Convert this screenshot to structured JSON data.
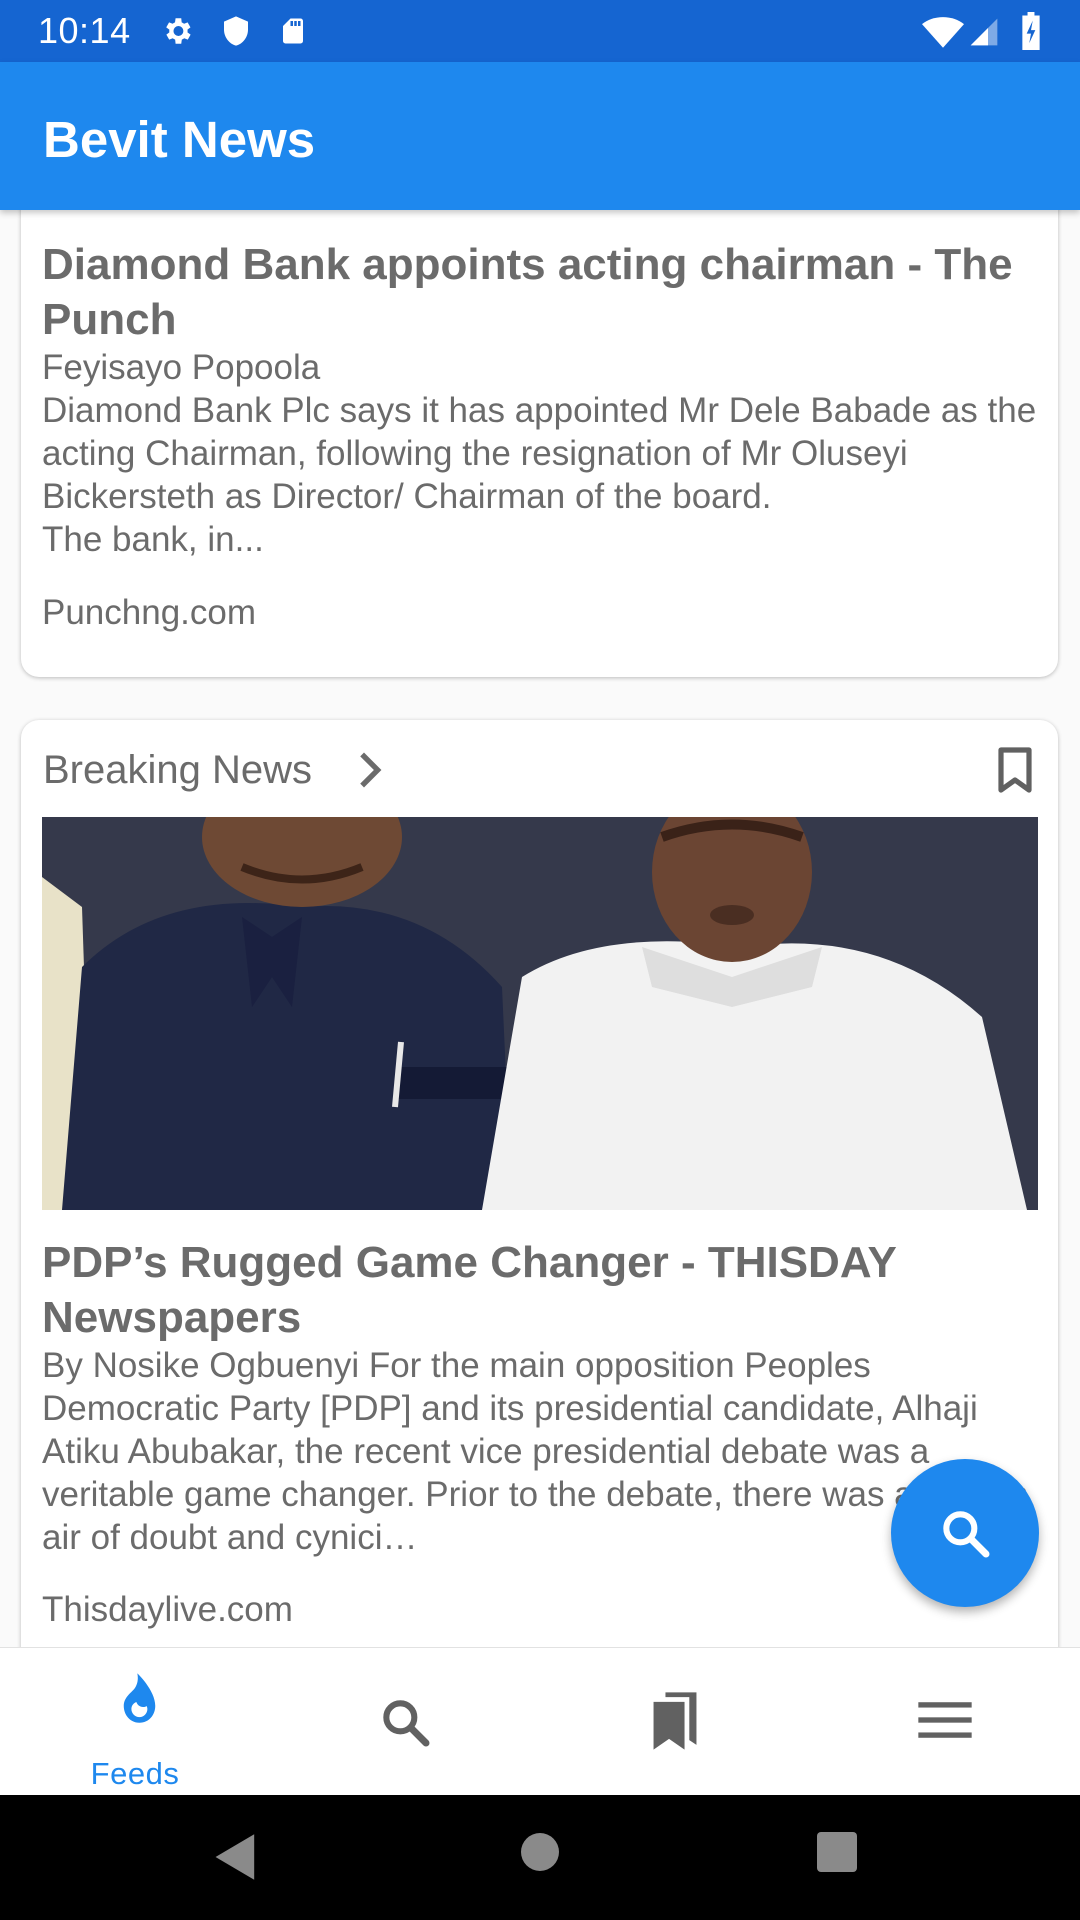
{
  "status_bar": {
    "time": "10:14",
    "icons": [
      "settings-icon",
      "shield-icon",
      "sd-card-icon",
      "wifi-icon",
      "signal-icon",
      "battery-icon"
    ]
  },
  "app_bar": {
    "title": "Bevit News"
  },
  "articles": [
    {
      "title": "Diamond Bank appoints acting chairman - The Punch",
      "description": "Feyisayo Popoola\nDiamond Bank Plc says it has appointed Mr Dele Babade as the acting Chairman, following the resignation of Mr Oluseyi Bickersteth as Director/ Chairman of the board.\nThe bank, in...",
      "source": "Punchng.com"
    },
    {
      "category": "Breaking News",
      "title": "PDP’s Rugged Game Changer - THISDAY Newspapers",
      "description": "By Nosike Ogbuenyi For the main opposition Peoples Democratic Party [PDP] and its presidential candidate, Alhaji Atiku Abubakar, the recent vice presidential debate was a veritable game changer. Prior to the debate, there was a certain air of doubt and cynici…",
      "source": "Thisdaylive.com"
    }
  ],
  "bottom_nav": [
    {
      "label": "Feeds",
      "icon": "flame-icon",
      "active": true
    },
    {
      "label": "",
      "icon": "search-icon",
      "active": false
    },
    {
      "label": "",
      "icon": "bookmarks-icon",
      "active": false
    },
    {
      "label": "",
      "icon": "menu-icon",
      "active": false
    }
  ],
  "colors": {
    "status_bar": "#1565d1",
    "app_bar": "#1e88ee",
    "accent": "#1e88ee",
    "text": "#6b6b6b",
    "icon_inactive": "#616161"
  }
}
